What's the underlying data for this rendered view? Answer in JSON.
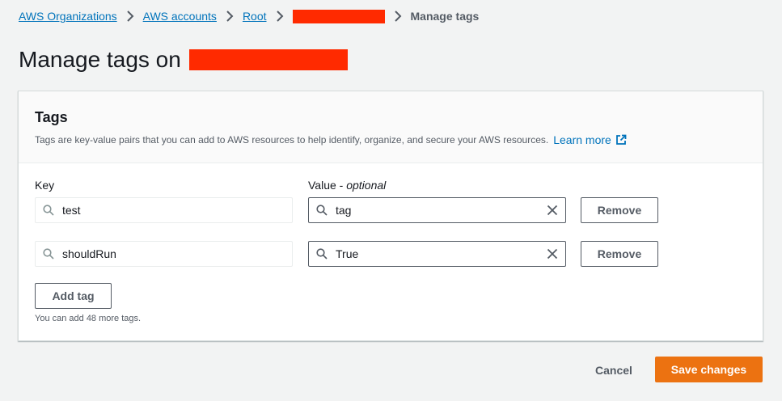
{
  "breadcrumb": {
    "items": [
      "AWS Organizations",
      "AWS accounts",
      "Root"
    ],
    "current": "Manage tags"
  },
  "page": {
    "title": "Manage tags on"
  },
  "tags_panel": {
    "title": "Tags",
    "description": "Tags are key-value pairs that you can add to AWS resources to help identify, organize, and secure your AWS resources.",
    "learn_more": "Learn more",
    "key_label": "Key",
    "value_label": "Value -",
    "value_label_optional": "optional",
    "rows": [
      {
        "key": "test",
        "value": "tag",
        "remove_label": "Remove"
      },
      {
        "key": "shouldRun",
        "value": "True",
        "remove_label": "Remove"
      }
    ],
    "add_tag_label": "Add tag",
    "remaining_note": "You can add 48 more tags."
  },
  "actions": {
    "cancel_label": "Cancel",
    "save_label": "Save changes"
  },
  "colors": {
    "link": "#0073bb",
    "primary_button": "#ec7211",
    "redaction": "#ff2a00",
    "background": "#f2f3f3"
  },
  "icons": [
    "chevron-right-icon",
    "external-link-icon",
    "search-icon",
    "clear-icon"
  ]
}
